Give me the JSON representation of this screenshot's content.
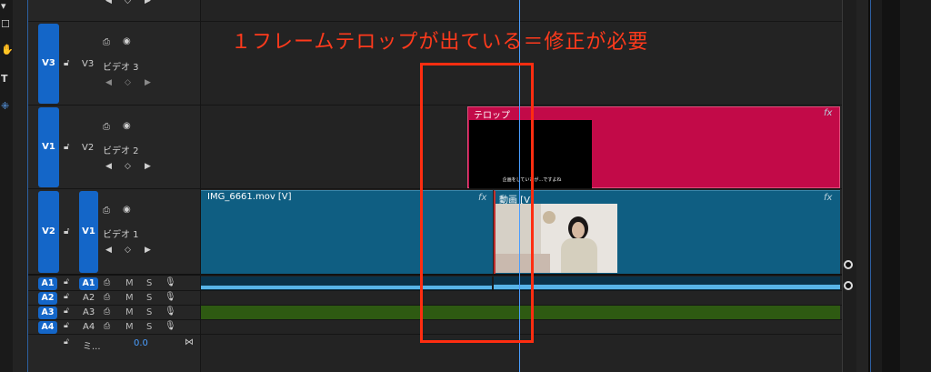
{
  "annotation": {
    "note": "１フレームテロップが出ている＝修正が必要"
  },
  "tools": {
    "icons": [
      "shape-tool-icon",
      "hand-tool-icon",
      "type-tool-icon",
      "slip-tool-icon"
    ],
    "type_glyph": "T"
  },
  "tracks": {
    "v3": {
      "src": "V3",
      "target": "V3",
      "name": "ビデオ 3"
    },
    "v2": {
      "src": "V1",
      "target": "V2",
      "name": "ビデオ 2"
    },
    "v1": {
      "src": "V2",
      "target": "V1",
      "name": "ビデオ 1"
    },
    "audio": [
      {
        "src": "A1",
        "target": "A1",
        "m": "M",
        "s": "S"
      },
      {
        "src": "A2",
        "target": "A2",
        "m": "M",
        "s": "S"
      },
      {
        "src": "A3",
        "target": "A3",
        "m": "M",
        "s": "S"
      },
      {
        "src": "A4",
        "target": "A4",
        "m": "M",
        "s": "S"
      }
    ],
    "mix": {
      "name": "ミ...",
      "value": "0.0"
    }
  },
  "clips": {
    "telop": {
      "title": "テロップ",
      "fx": "fx",
      "subtitle": "企画をしていたが…ですよね"
    },
    "img": {
      "title": "IMG_6661.mov [V]",
      "fx": "fx"
    },
    "video": {
      "title": "動画 [V]",
      "fx": "fx"
    }
  },
  "colors": {
    "target_blue": "#1466c8",
    "telop_clip": "#c20a48",
    "video_clip": "#0f5e82",
    "audio_wave": "#57b4e8",
    "audio_green": "#2e5a12",
    "annotation_red": "#ff2d10"
  }
}
